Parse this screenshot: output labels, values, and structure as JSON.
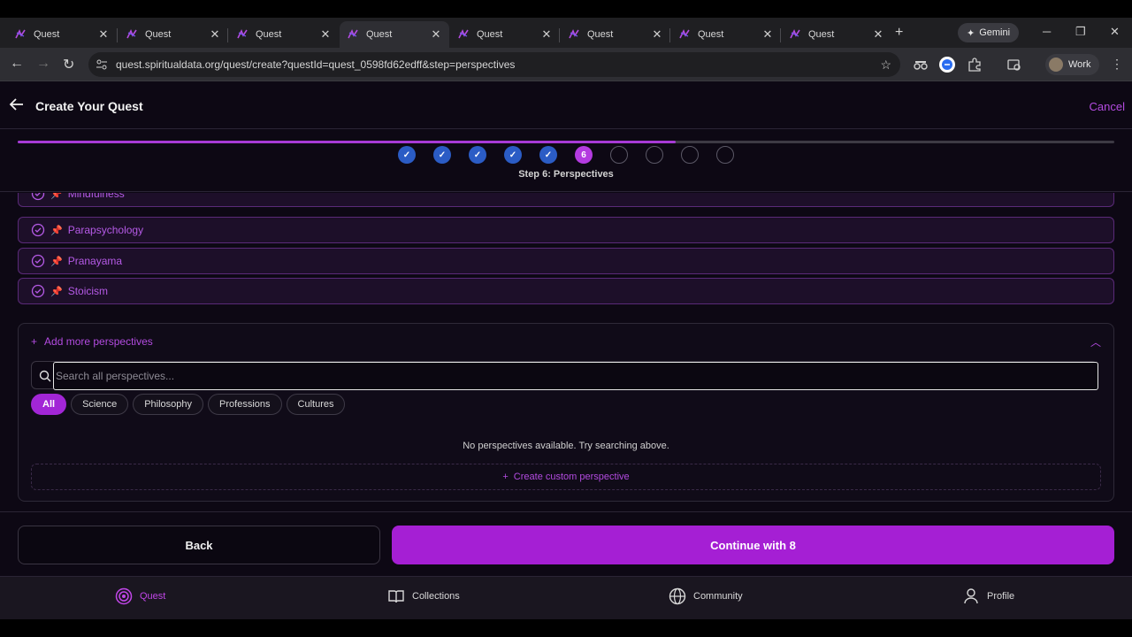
{
  "browser": {
    "tabs": [
      {
        "title": "Quest"
      },
      {
        "title": "Quest"
      },
      {
        "title": "Quest"
      },
      {
        "title": "Quest",
        "active": true
      },
      {
        "title": "Quest"
      },
      {
        "title": "Quest"
      },
      {
        "title": "Quest"
      },
      {
        "title": "Quest"
      }
    ],
    "gemini_label": "Gemini",
    "url": "quest.spiritualdata.org/quest/create?questId=quest_0598fd62edff&step=perspectives",
    "profile_label": "Work"
  },
  "header": {
    "title": "Create Your Quest",
    "cancel_label": "Cancel"
  },
  "progress": {
    "fraction": 0.6,
    "steps": [
      {
        "state": "done",
        "label": "✓"
      },
      {
        "state": "done",
        "label": "✓"
      },
      {
        "state": "done",
        "label": "✓"
      },
      {
        "state": "done",
        "label": "✓"
      },
      {
        "state": "done",
        "label": "✓"
      },
      {
        "state": "current",
        "label": "6"
      },
      {
        "state": "todo",
        "label": ""
      },
      {
        "state": "todo",
        "label": ""
      },
      {
        "state": "todo",
        "label": ""
      },
      {
        "state": "todo",
        "label": ""
      }
    ],
    "caption": "Step 6: Perspectives"
  },
  "selected_perspectives": [
    {
      "label": "Mindfulness"
    },
    {
      "label": "Parapsychology"
    },
    {
      "label": "Pranayama"
    },
    {
      "label": "Stoicism"
    }
  ],
  "add_panel": {
    "title": "Add more perspectives",
    "search_placeholder": "Search all perspectives...",
    "filters": [
      {
        "label": "All",
        "active": true
      },
      {
        "label": "Science"
      },
      {
        "label": "Philosophy"
      },
      {
        "label": "Professions"
      },
      {
        "label": "Cultures"
      }
    ],
    "empty_message": "No perspectives available. Try searching above.",
    "create_custom_label": "Create custom perspective"
  },
  "actions": {
    "back_label": "Back",
    "continue_label": "Continue with 8"
  },
  "bottom_nav": {
    "items": [
      {
        "label": "Quest",
        "active": true
      },
      {
        "label": "Collections"
      },
      {
        "label": "Community"
      },
      {
        "label": "Profile"
      }
    ]
  },
  "colors": {
    "accent": "#a51fd4",
    "step_done": "#2b5cc5",
    "background": "#0d0814"
  }
}
